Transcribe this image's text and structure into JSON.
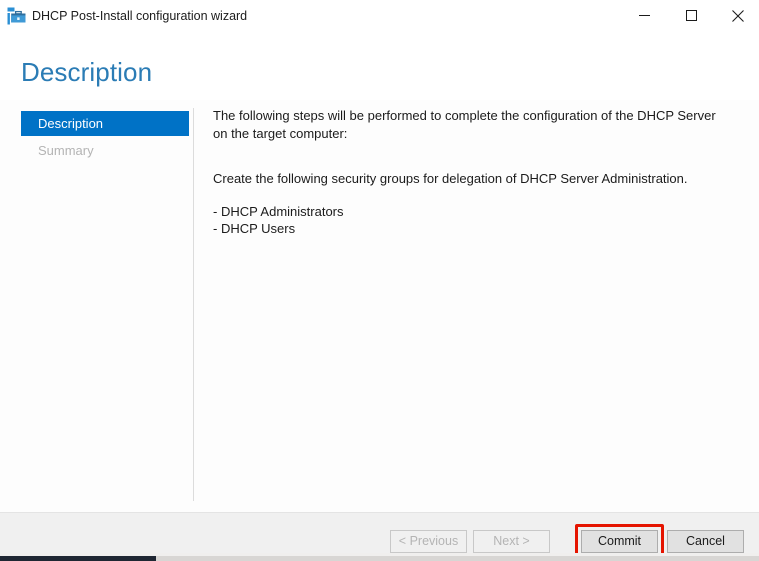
{
  "window": {
    "title": "DHCP Post-Install configuration wizard",
    "icon": "dhcp-server-icon",
    "controls": {
      "minimize": "minimize-icon",
      "maximize": "maximize-icon",
      "close": "close-icon"
    }
  },
  "header": {
    "page_title": "Description",
    "accent_color": "#2b7cb5"
  },
  "nav": {
    "items": [
      {
        "label": "Description",
        "state": "active"
      },
      {
        "label": "Summary",
        "state": "disabled"
      }
    ],
    "active_color": "#0072c6",
    "disabled_color": "#b4b4b4"
  },
  "content": {
    "intro": "The following steps will be performed to complete the configuration of the DHCP Server on the target computer:",
    "create_line": "Create the following security groups for delegation of DHCP Server Administration.",
    "bullets": [
      "- DHCP Administrators",
      "- DHCP Users"
    ]
  },
  "footer": {
    "previous": "< Previous",
    "next": "Next >",
    "commit": "Commit",
    "cancel": "Cancel",
    "highlight_color": "#e51400"
  }
}
